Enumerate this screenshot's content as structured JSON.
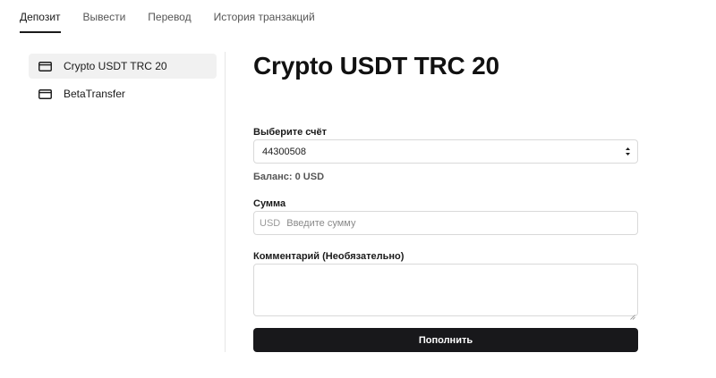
{
  "tabs": [
    {
      "label": "Депозит",
      "active": true
    },
    {
      "label": "Вывести",
      "active": false
    },
    {
      "label": "Перевод",
      "active": false
    },
    {
      "label": "История транзакций",
      "active": false
    }
  ],
  "sidebar": {
    "items": [
      {
        "label": "Crypto USDT TRC 20",
        "icon": "card-icon",
        "active": true
      },
      {
        "label": "BetaTransfer",
        "icon": "card-icon",
        "active": false
      }
    ]
  },
  "main": {
    "title": "Crypto USDT TRC 20",
    "account": {
      "label": "Выберите счёт",
      "value": "44300508"
    },
    "balance": "Баланс: 0 USD",
    "amount": {
      "label": "Сумма",
      "currency": "USD",
      "placeholder": "Введите сумму"
    },
    "comment": {
      "label": "Комментарий (Необязательно)"
    },
    "submit_label": "Пополнить"
  },
  "colors": {
    "accent": "#18181b",
    "sidebar_active_bg": "#f1f1f1",
    "border": "#d9d9d9"
  }
}
